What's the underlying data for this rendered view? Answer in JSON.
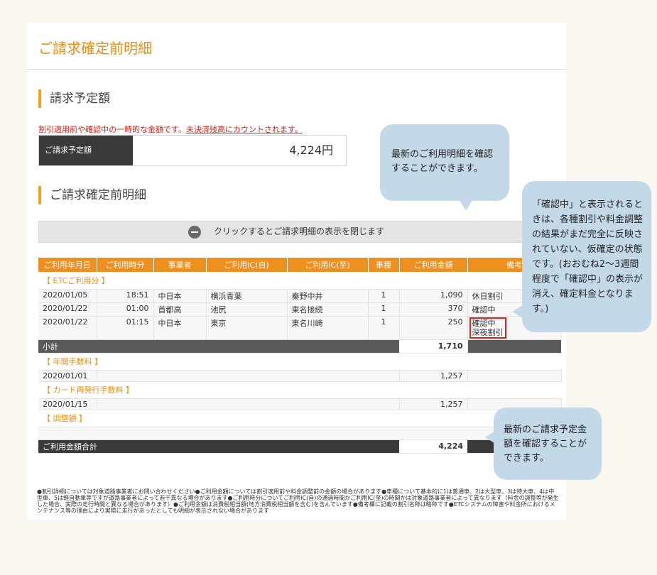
{
  "page_title": "ご請求確定前明細",
  "section_estimate": {
    "heading": "請求予定額",
    "notice": "割引適用前や確認中の一時的な金額です。",
    "notice_link": "未決済残高にカウントされます。",
    "label": "ご請求予定額",
    "amount": "4,224円"
  },
  "section_details": {
    "heading": "ご請求確定前明細",
    "toggle_text": "クリックするとご請求明細の表示を閉じます"
  },
  "table": {
    "headers": [
      "ご利用年月日",
      "ご利用時分",
      "事業者",
      "ご利用IC(自)",
      "ご利用IC(至)",
      "車種",
      "ご利用金額",
      "備考"
    ],
    "cat_etc": "【 ETCご利用分 】",
    "etc_rows": [
      {
        "date": "2020/01/05",
        "time": "18:51",
        "operator": "中日本",
        "from": "横浜青葉",
        "to": "秦野中井",
        "type": "1",
        "amount": "1,090",
        "note": "休日割引"
      },
      {
        "date": "2020/01/22",
        "time": "01:00",
        "operator": "首都高",
        "from": "池尻",
        "to": "東名接続",
        "type": "1",
        "amount": "370",
        "note": "確認中"
      },
      {
        "date": "2020/01/22",
        "time": "01:15",
        "operator": "中日本",
        "from": "東京",
        "to": "東名川崎",
        "type": "1",
        "amount": "250",
        "note1": "確認中",
        "note2": "深夜割引"
      }
    ],
    "subtotal_label": "小計",
    "subtotal_value": "1,710",
    "cat_annual": "【 年間手数料 】",
    "annual_row": {
      "date": "2020/01/01",
      "amount": "1,257"
    },
    "cat_card": "【 カード再発行手数料 】",
    "card_row": {
      "date": "2020/01/15",
      "amount": "1,257"
    },
    "cat_adjust": "【 調整額 】",
    "total_label": "ご利用金額合計",
    "total_value": "4,224"
  },
  "footnote": "●割引詳細については対象道路事業者にお問い合わせください●ご利用金額については割引適用前や料金調整前の金額の場合があります●車種について基本的に1は普通車、2は大型車、3は特大車、4は中型車、5は軽自動車等ですが道路事業者によって若干異なる場合があります●ご利用時分についてご利用IC(自)の通過時間かご利用IC(至)の時間かは対象道路事業者によって異なります（料金の調整等が発生した場合、実際の走行時間と異なる場合があります）●ご利用金額は消費税相当額(地方消費税相当額を含む)を含んでいます●備考欄に記載の割引名称は略称です●ETCシステムの障害や料金所におけるメンテナンス等の理由により実際に走行があったとしても明細が表示されない場合があります",
  "callouts": {
    "latest": "最新のご利用明細を確認することができます。",
    "confirming": "「確認中」と表示されるときは、各種割引や料金調整の結果がまだ完全に反映されていない、仮確定の状態です。(おおむね2〜3週間程度で「確認中」の表示が消え、確定料金となります。)",
    "estimate": "最新のご請求予定金額を確認することができます。"
  }
}
